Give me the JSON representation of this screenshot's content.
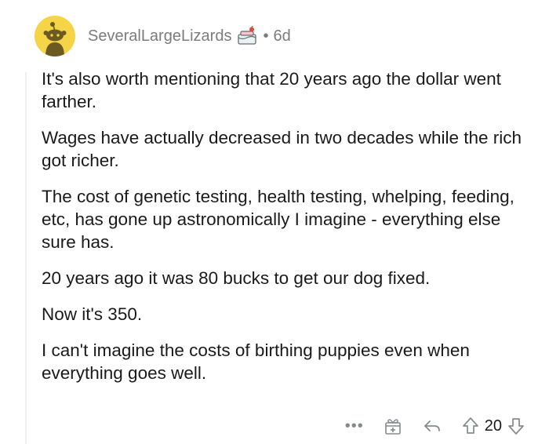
{
  "comment": {
    "username": "SeveralLargeLizards",
    "separator": "•",
    "age": "6d",
    "paragraphs": [
      "It's also worth mentioning that 20 years ago the dollar went farther.",
      "Wages have actually decreased in two decades while the rich got richer.",
      "The cost of genetic testing, health testing, whelping, feeding, etc, has gone up astronomically I imagine - everything else sure has.",
      "20 years ago it was 80 bucks to get our dog fixed.",
      "Now it's 350.",
      "I can't imagine the costs of birthing puppies even when everything goes well."
    ]
  },
  "actions": {
    "more_label": "•••",
    "score": "20"
  },
  "icons": {
    "avatar": "snoo-avatar-icon",
    "flair": "cake-day-icon",
    "award": "gift-icon",
    "reply": "reply-arrow-icon",
    "upvote": "upvote-icon",
    "downvote": "downvote-icon"
  },
  "colors": {
    "avatar_bg": "#f5d547",
    "meta_text": "#7c7c7c",
    "body_text": "#1a1a1b",
    "icon_gray": "#878a8c"
  }
}
